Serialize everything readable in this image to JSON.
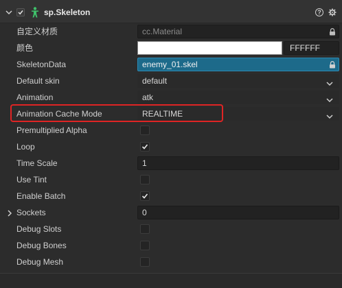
{
  "component": {
    "title": "sp.Skeleton",
    "enabled": true,
    "icons": {
      "collapse": "chevron-down-icon",
      "component": "skeleton-person-icon",
      "help": "help-icon",
      "settings": "gear-icon"
    }
  },
  "properties": {
    "custom_material": {
      "label": "自定义材质",
      "value": "cc.Material"
    },
    "color": {
      "label": "颜色",
      "hex": "FFFFFF",
      "swatch": "#ffffff"
    },
    "skeleton_data": {
      "label": "SkeletonData",
      "value": "enemy_01.skel"
    },
    "default_skin": {
      "label": "Default skin",
      "value": "default"
    },
    "animation": {
      "label": "Animation",
      "value": "atk"
    },
    "animation_cache_mode": {
      "label": "Animation Cache Mode",
      "value": "REALTIME"
    },
    "premultiplied_alpha": {
      "label": "Premultiplied Alpha",
      "checked": false
    },
    "loop": {
      "label": "Loop",
      "checked": true
    },
    "time_scale": {
      "label": "Time Scale",
      "value": "1"
    },
    "use_tint": {
      "label": "Use Tint",
      "checked": false
    },
    "enable_batch": {
      "label": "Enable Batch",
      "checked": true
    },
    "sockets": {
      "label": "Sockets",
      "value": "0"
    },
    "debug_slots": {
      "label": "Debug Slots",
      "checked": false
    },
    "debug_bones": {
      "label": "Debug Bones",
      "checked": false
    },
    "debug_mesh": {
      "label": "Debug Mesh",
      "checked": false
    }
  },
  "colors": {
    "highlight_box": "#e02424",
    "asset_highlight": "#1d6a8a",
    "component_icon": "#3fc06a"
  }
}
